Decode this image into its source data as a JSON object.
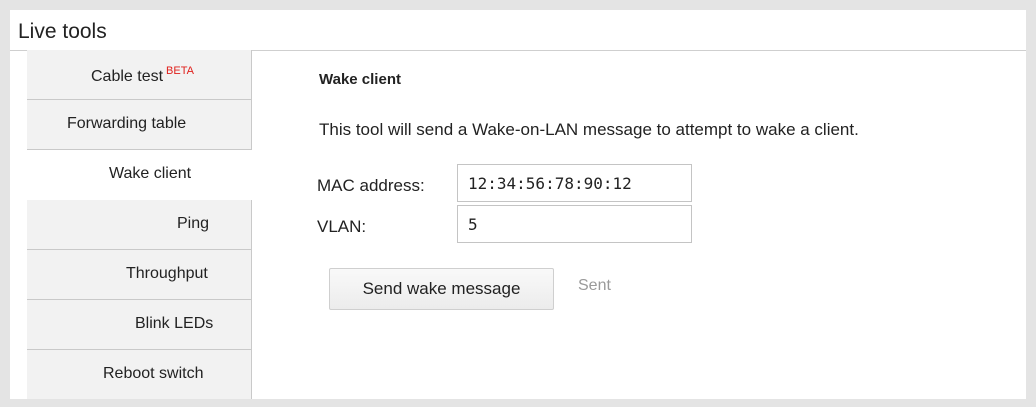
{
  "panel": {
    "title": "Live tools"
  },
  "tabs": [
    {
      "label": "Cable test",
      "badge": "BETA",
      "active": false
    },
    {
      "label": "Forwarding table",
      "active": false
    },
    {
      "label": "Wake client",
      "active": true
    },
    {
      "label": "Ping",
      "active": false
    },
    {
      "label": "Throughput",
      "active": false
    },
    {
      "label": "Blink LEDs",
      "active": false
    },
    {
      "label": "Reboot switch",
      "active": false
    }
  ],
  "wake_client": {
    "title": "Wake client",
    "description": "This tool will send a Wake-on-LAN message to attempt to wake a client.",
    "mac_label": "MAC address:",
    "mac_value": "12:34:56:78:90:12",
    "vlan_label": "VLAN:",
    "vlan_value": "5",
    "send_button": "Send wake message",
    "status": "Sent"
  },
  "colors": {
    "background": "#e4e4e4",
    "tab_inactive": "#f2f2f2",
    "beta_badge": "#e0201c",
    "status_text": "#9a9a9a"
  }
}
